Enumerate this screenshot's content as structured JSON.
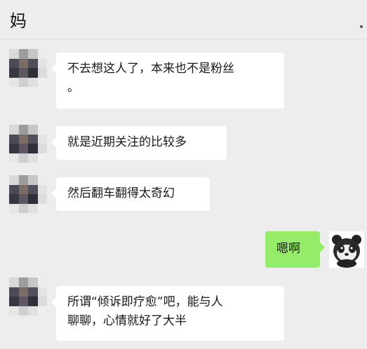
{
  "header": {
    "title": "妈"
  },
  "messages": [
    {
      "side": "left",
      "text_line1": "不去想这人了，本来也不是粉丝",
      "text_line2": "。"
    },
    {
      "side": "left",
      "text": "就是近期关注的比较多"
    },
    {
      "side": "left",
      "text": "然后翻车翻得太奇幻"
    },
    {
      "side": "right",
      "text": "嗯啊"
    },
    {
      "side": "left",
      "text_line1": "所谓“倾诉即疗愈”吧，能与人",
      "text_line2": "聊聊，心情就好了大半"
    }
  ],
  "colors": {
    "background": "#ededed",
    "bubble_left": "#ffffff",
    "bubble_right": "#95ec69"
  },
  "icons": {
    "contact_avatar": "pixelated-avatar",
    "self_avatar": "panda-avatar-icon",
    "more": "more-dots-icon"
  }
}
